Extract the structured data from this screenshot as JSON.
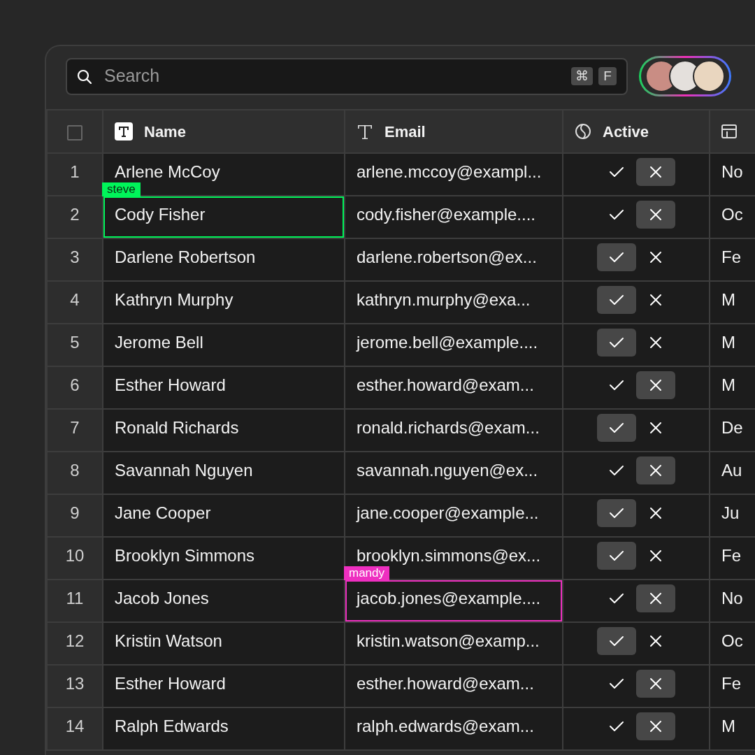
{
  "search": {
    "placeholder": "Search",
    "shortcut": [
      "⌘",
      "F"
    ]
  },
  "avatars": [
    {
      "kind": "photo"
    },
    {
      "kind": "photo"
    },
    {
      "kind": "photo"
    }
  ],
  "select_all": {
    "checked": false
  },
  "columns": [
    {
      "kind": "title",
      "label": "Name"
    },
    {
      "kind": "text",
      "label": "Email"
    },
    {
      "kind": "boolean",
      "label": "Active"
    },
    {
      "kind": "calendar"
    }
  ],
  "rows": [
    {
      "number": "1",
      "name": "Arlene McCoy",
      "email": "arlene.mccoy@exampl...",
      "active": false,
      "column_4": "No"
    },
    {
      "number": "2",
      "name": "Cody Fisher",
      "email": "cody.fisher@example....",
      "active": false,
      "column_4": "Oc",
      "name_cursor": {
        "user": "steve",
        "color": "#00f55a"
      }
    },
    {
      "number": "3",
      "name": "Darlene Robertson",
      "email": "darlene.robertson@ex...",
      "active": true,
      "column_4": "Fe"
    },
    {
      "number": "4",
      "name": "Kathryn Murphy",
      "email": "kathryn.murphy@exa...",
      "active": true,
      "column_4": "M"
    },
    {
      "number": "5",
      "name": "Jerome Bell",
      "email": "jerome.bell@example....",
      "active": true,
      "column_4": "M"
    },
    {
      "number": "6",
      "name": "Esther Howard",
      "email": "esther.howard@exam...",
      "active": false,
      "column_4": "M"
    },
    {
      "number": "7",
      "name": "Ronald Richards",
      "email": "ronald.richards@exam...",
      "active": true,
      "column_4": "De"
    },
    {
      "number": "8",
      "name": "Savannah Nguyen",
      "email": "savannah.nguyen@ex...",
      "active": false,
      "column_4": "Au"
    },
    {
      "number": "9",
      "name": "Jane Cooper",
      "email": "jane.cooper@example...",
      "active": true,
      "column_4": "Ju"
    },
    {
      "number": "10",
      "name": "Brooklyn Simmons",
      "email": "brooklyn.simmons@ex...",
      "active": true,
      "column_4": "Fe"
    },
    {
      "number": "11",
      "name": "Jacob Jones",
      "email": "jacob.jones@example....",
      "active": false,
      "column_4": "No",
      "email_cursor": {
        "user": "mandy",
        "color": "#ee2fc0"
      }
    },
    {
      "number": "12",
      "name": "Kristin Watson",
      "email": "kristin.watson@examp...",
      "active": true,
      "column_4": "Oc"
    },
    {
      "number": "13",
      "name": "Esther Howard",
      "email": "esther.howard@exam...",
      "active": false,
      "column_4": "Fe"
    },
    {
      "number": "14",
      "name": "Ralph Edwards",
      "email": "ralph.edwards@exam...",
      "active": false,
      "column_4": "M"
    }
  ]
}
